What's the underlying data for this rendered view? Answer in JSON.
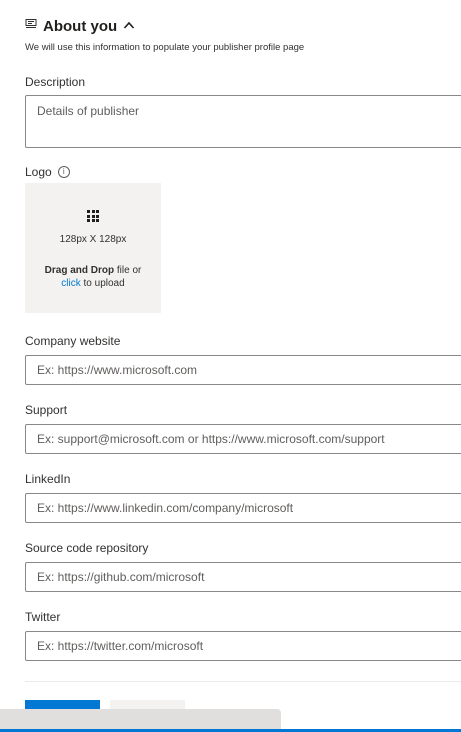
{
  "section": {
    "title": "About you",
    "subtitle": "We will use this information to populate your publisher profile page"
  },
  "description": {
    "label": "Description",
    "placeholder": "Details of publisher"
  },
  "logo": {
    "label": "Logo",
    "size_text": "128px X 128px",
    "drag_drop_bold": "Drag and Drop",
    "drag_drop_rest": " file or",
    "click_link": "click",
    "click_rest": " to upload"
  },
  "fields": {
    "company_website": {
      "label": "Company website",
      "placeholder": "Ex: https://www.microsoft.com"
    },
    "support": {
      "label": "Support",
      "placeholder": "Ex: support@microsoft.com or https://www.microsoft.com/support"
    },
    "linkedin": {
      "label": "LinkedIn",
      "placeholder": "Ex: https://www.linkedin.com/company/microsoft"
    },
    "source_code": {
      "label": "Source code repository",
      "placeholder": "Ex: https://github.com/microsoft"
    },
    "twitter": {
      "label": "Twitter",
      "placeholder": "Ex: https://twitter.com/microsoft"
    }
  },
  "icons": {
    "section_icon": "card-icon",
    "collapse_icon": "chevron-up-icon",
    "info_icon": "info-icon",
    "upload_icon": "grid-icon"
  },
  "colors": {
    "accent": "#0078d4",
    "border": "#8a8886",
    "upload_bg": "#f3f2f1"
  }
}
